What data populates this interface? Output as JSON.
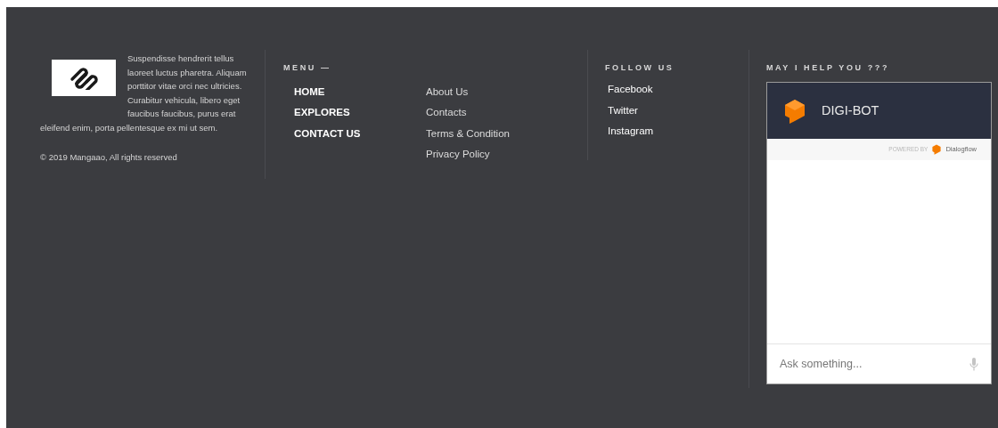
{
  "about": {
    "text_beside_logo": "Suspendisse hendrerit tellus laoreet luctus pharetra. Aliquam porttitor vitae orci nec ultricies. Curabitur vehicula, libero eget faucibus faucibus, purus erat",
    "text_below_logo": "eleifend enim, porta pellentesque ex mi ut sem.",
    "copyright": "© 2019 Mangaao, All rights reserved"
  },
  "menu": {
    "title": "MENU —",
    "primary": [
      "HOME",
      "EXPLORES",
      "CONTACT US"
    ],
    "secondary": [
      "About Us",
      "Contacts",
      "Terms & Condition",
      "Privacy Policy"
    ]
  },
  "follow": {
    "title": "FOLLOW US",
    "links": [
      "Facebook",
      "Twitter",
      "Instagram"
    ]
  },
  "chat": {
    "title": "MAY I HELP YOU ???",
    "bot_name": "DIGI-BOT",
    "powered_by": "POWERED BY",
    "provider": "Dialogflow",
    "placeholder": "Ask something..."
  }
}
